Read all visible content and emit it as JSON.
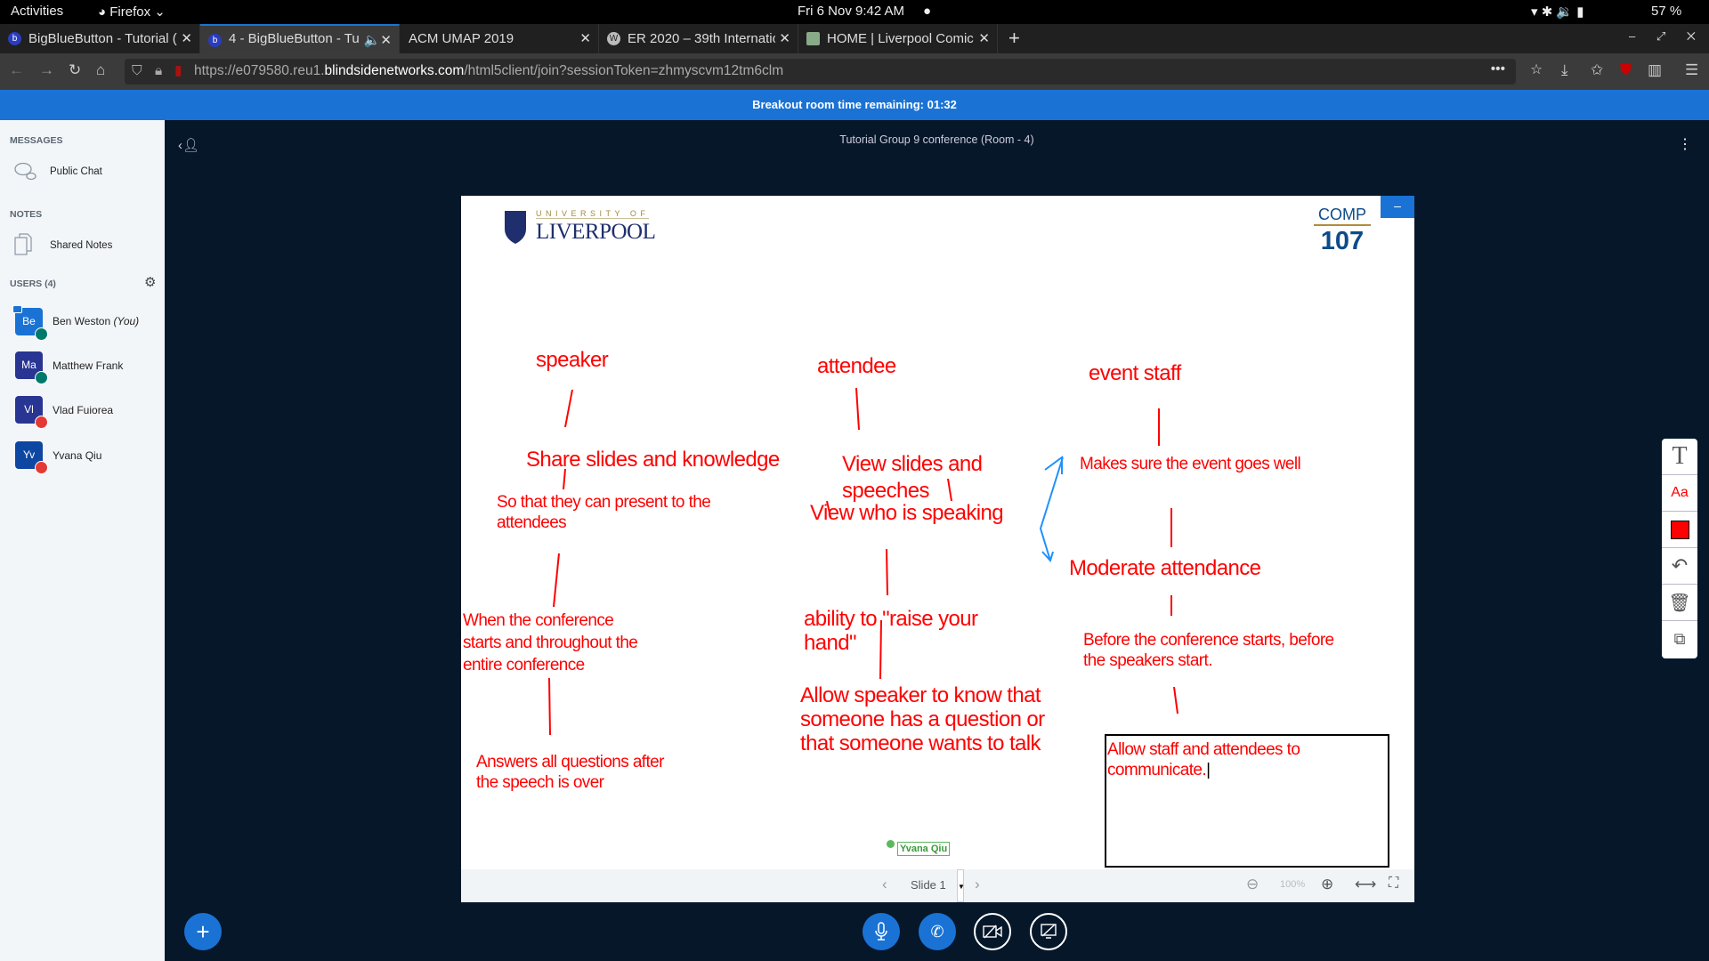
{
  "system": {
    "activities": "Activities",
    "app": "Firefox",
    "datetime": "Fri 6 Nov  9:42 AM",
    "battery": "57 %"
  },
  "tabs": [
    {
      "label": "BigBlueButton - Tutorial (",
      "icon": "bbb-icon"
    },
    {
      "label": "4 - BigBlueButton - Tu",
      "icon": "bbb-icon",
      "active": true
    },
    {
      "label": "ACM UMAP 2019"
    },
    {
      "label": "ER 2020 – 39th Internatio",
      "icon": "wordpress-icon"
    },
    {
      "label": "HOME | Liverpool Comic (",
      "icon": "page-icon"
    }
  ],
  "url": {
    "prefix": "https://e079580.reu1.",
    "domain": "blindsidenetworks.com",
    "path": "/html5client/join?sessionToken=zhmyscvm12tm6clm"
  },
  "banner": "Breakout room time remaining: 01:32",
  "sidebar": {
    "messages_header": "MESSAGES",
    "public_chat": "Public Chat",
    "notes_header": "NOTES",
    "shared_notes": "Shared Notes",
    "users_header": "USERS (4)",
    "users": [
      {
        "initials": "Be",
        "name": "Ben Weston",
        "you": "(You)",
        "color": "#1a73d4",
        "mic": "#00796b"
      },
      {
        "initials": "Ma",
        "name": "Matthew Frank",
        "color": "#283593",
        "mic": "#00796b"
      },
      {
        "initials": "Vl",
        "name": "Vlad Fuiorea",
        "color": "#283593",
        "mic": "#e53935"
      },
      {
        "initials": "Yv",
        "name": "Yvana Qiu",
        "color": "#0d47a1",
        "mic": "#e53935"
      }
    ]
  },
  "meeting_title": "Tutorial Group 9 conference (Room - 4)",
  "slide": {
    "logo_top": "UNIVERSITY OF",
    "logo_main": "LIVERPOOL",
    "course_code": "COMP",
    "course_number": "107",
    "annotations": {
      "speaker": "speaker",
      "attendee": "attendee",
      "event_staff": "event staff",
      "share": "Share slides and knowledge",
      "so_that_1": "So that they can present to the",
      "so_that_2": "attendees",
      "view_slides_1": "View slides and",
      "view_slides_2": "speeches",
      "view_who": "View who is speaking",
      "makes_sure": "Makes sure the event goes well",
      "moderate": "Moderate attendance",
      "when_1": "When the conference",
      "when_2": "starts and throughout the",
      "when_3": "entire conference",
      "raise_1": "ability to \"raise your",
      "raise_2": "hand\"",
      "before_1": "Before the conference starts, before",
      "before_2": "the speakers start.",
      "allow_1": "Allow speaker to know that",
      "allow_2": "someone has a question or",
      "allow_3": "that someone wants to talk",
      "answers_1": "Answers all questions after",
      "answers_2": "the speech is over",
      "textbox_1": "Allow staff and attendees to",
      "textbox_2": "communicate."
    },
    "cursor_label": "Yvana Qiu",
    "annotation_color": "#ff0000"
  },
  "slide_controls": {
    "slide": "Slide 1",
    "zoom": "100%"
  }
}
